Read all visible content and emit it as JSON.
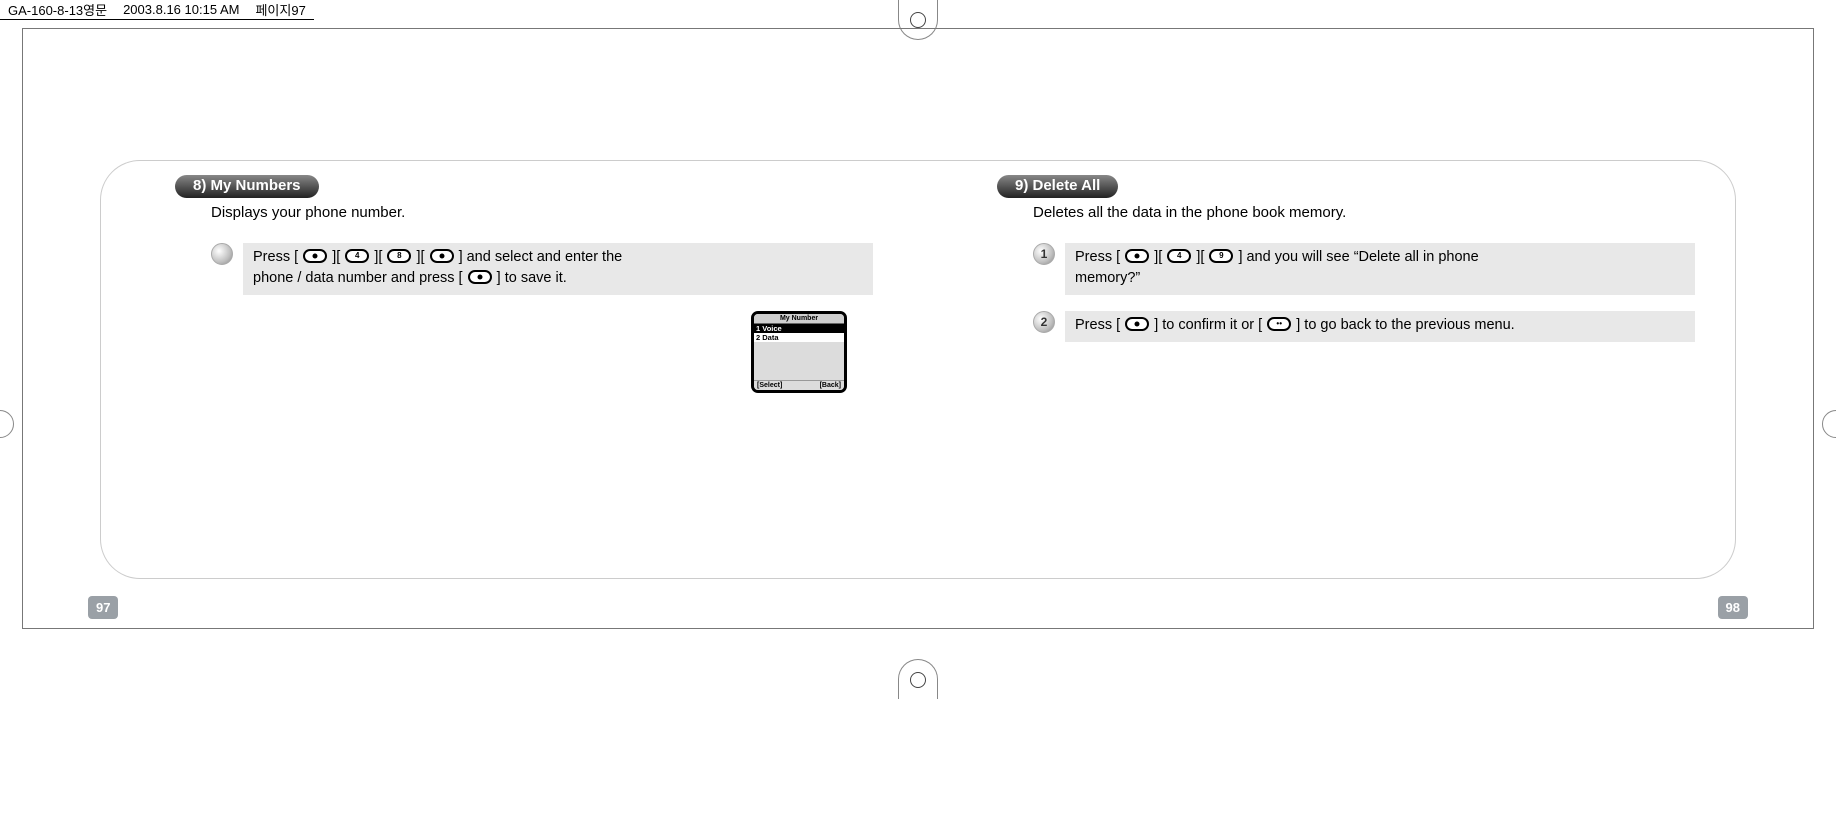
{
  "doc_header": {
    "filename": "GA-160-8-13영문",
    "timestamp": "2003.8.16 10:15 AM",
    "page_marker": "페이지97"
  },
  "left": {
    "pill": "8) My Numbers",
    "desc": "Displays your phone number.",
    "instruction": {
      "pre": "Press [",
      "mid1": "][",
      "mid2": "][",
      "mid3": "][",
      "post1": "] and select and enter the",
      "line2a": "phone / data number and press [",
      "line2b": "] to save it."
    },
    "phone": {
      "title": "My Number",
      "item1": "1 Voice",
      "item2": "2 Data",
      "left_soft": "[Select]",
      "right_soft": "[Back]"
    },
    "page": "97"
  },
  "right": {
    "pill": "9) Delete All",
    "desc": "Deletes all the data in the phone book memory.",
    "step1": {
      "num": "1",
      "pre": "Press [",
      "mid1": "][",
      "mid2": "][",
      "post": "] and you will see “Delete all in phone",
      "line2": "memory?”"
    },
    "step2": {
      "num": "2",
      "pre": "Press [",
      "mid": "] to confirm it or [",
      "post": "] to go back to the previous menu."
    },
    "page": "98"
  }
}
